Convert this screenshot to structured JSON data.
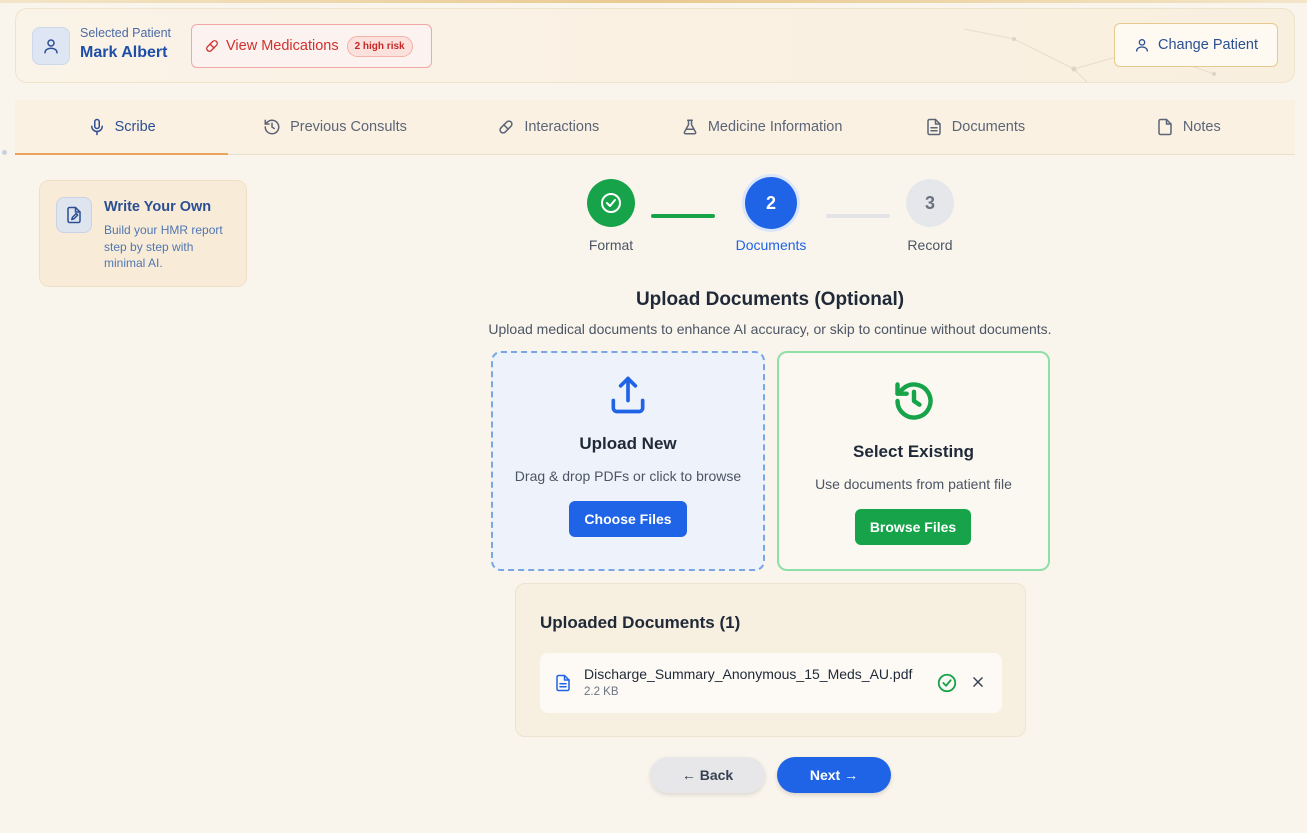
{
  "header": {
    "patient_caption": "Selected Patient",
    "patient_name": "Mark Albert",
    "view_medications_label": "View Medications",
    "risk_badge": "2 high risk",
    "change_patient_label": "Change Patient"
  },
  "tabs": [
    {
      "label": "Scribe",
      "icon": "microphone-icon",
      "active": true
    },
    {
      "label": "Previous Consults",
      "icon": "history-icon"
    },
    {
      "label": "Interactions",
      "icon": "pill-icon"
    },
    {
      "label": "Medicine Information",
      "icon": "flask-icon"
    },
    {
      "label": "Documents",
      "icon": "document-icon"
    },
    {
      "label": "Notes",
      "icon": "note-icon"
    }
  ],
  "sidebar": {
    "card_title": "Write Your Own",
    "card_desc": "Build your HMR report step by step with minimal AI."
  },
  "stepper": {
    "steps": [
      {
        "number": "1",
        "label": "Format",
        "state": "done"
      },
      {
        "number": "2",
        "label": "Documents",
        "state": "current"
      },
      {
        "number": "3",
        "label": "Record",
        "state": "pending"
      }
    ]
  },
  "main": {
    "title": "Upload Documents (Optional)",
    "subtitle": "Upload medical documents to enhance AI accuracy, or skip to continue without documents.",
    "upload_card": {
      "title": "Upload New",
      "desc": "Drag & drop PDFs or click to browse",
      "button": "Choose Files"
    },
    "existing_card": {
      "title": "Select Existing",
      "desc": "Use documents from patient file",
      "button": "Browse Files"
    },
    "uploaded": {
      "heading": "Uploaded Documents (1)",
      "files": [
        {
          "name": "Discharge_Summary_Anonymous_15_Meds_AU.pdf",
          "size": "2.2 KB",
          "status": "uploaded"
        }
      ]
    },
    "back_label": "← Back",
    "next_label": "Next →"
  },
  "colors": {
    "primary": "#1f63e6",
    "success": "#16a34a",
    "danger": "#d0312d",
    "background": "#faf5ec"
  }
}
